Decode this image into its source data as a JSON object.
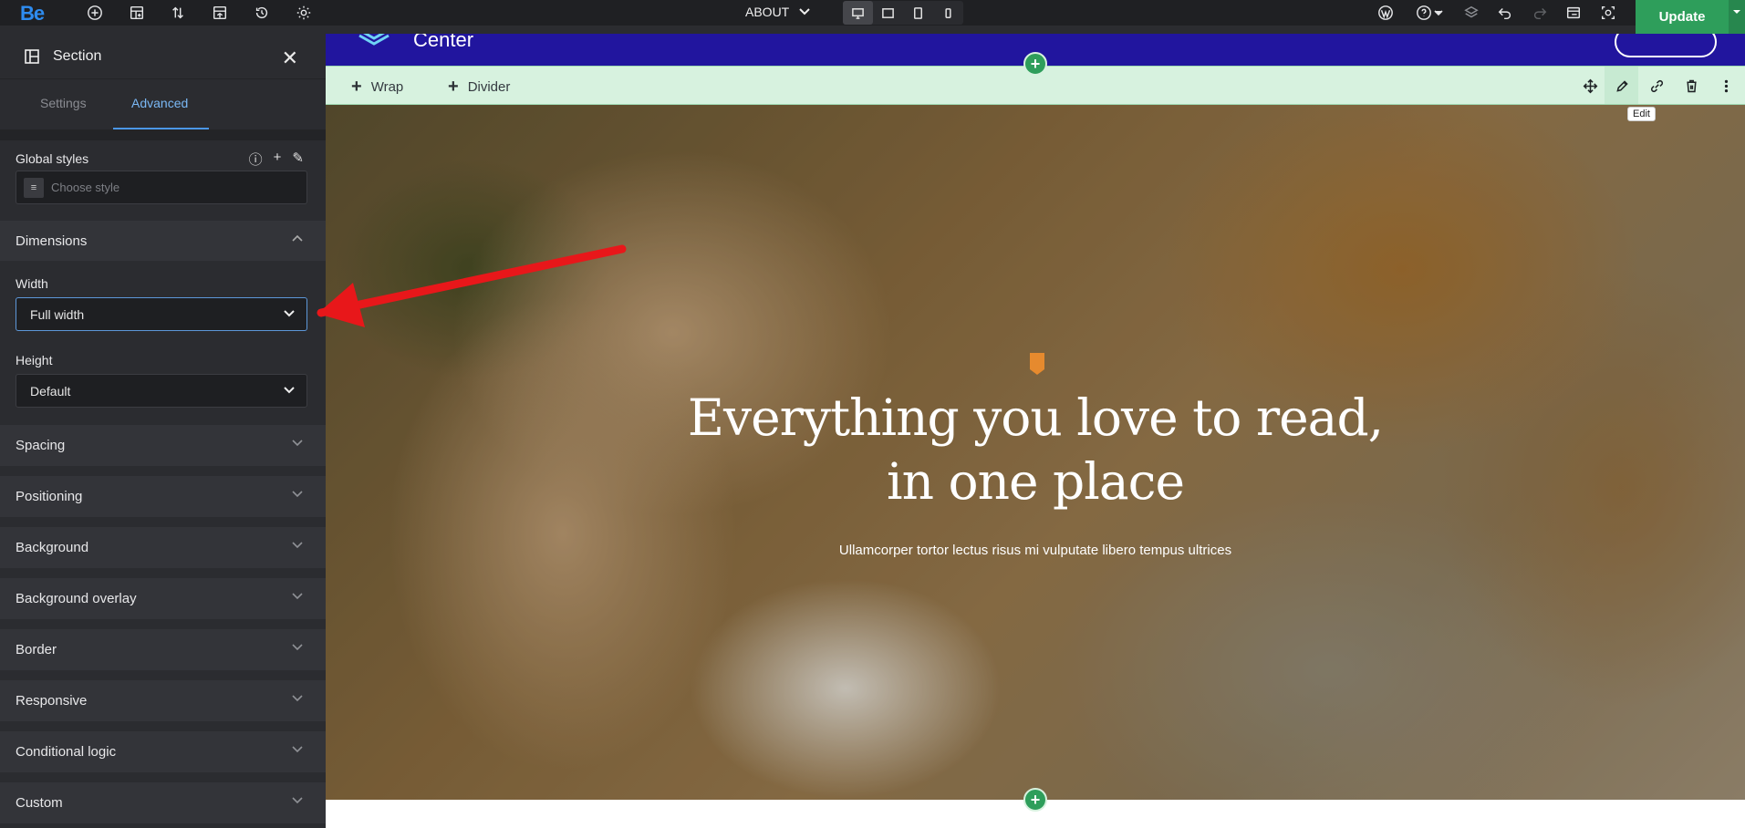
{
  "app": {
    "logo": "Be"
  },
  "topbar": {
    "page_name": "ABOUT",
    "update_label": "Update",
    "icons": [
      "add-icon",
      "layout-icon",
      "sort-icon",
      "templates-icon",
      "history-icon",
      "settings-icon",
      "wordpress-icon",
      "help-icon",
      "layers-icon",
      "undo-icon",
      "redo-icon",
      "preview-icon",
      "live-view-icon"
    ]
  },
  "sidebar": {
    "title": "Section",
    "tabs": [
      {
        "label": "Settings"
      },
      {
        "label": "Advanced"
      }
    ],
    "active_tab": "Advanced",
    "global_styles": {
      "label": "Global styles",
      "placeholder": "Choose style"
    },
    "dimensions": {
      "label": "Dimensions",
      "width": {
        "label": "Width",
        "value": "Full width"
      },
      "height": {
        "label": "Height",
        "value": "Default"
      }
    },
    "sections": [
      {
        "label": "Spacing"
      },
      {
        "label": "Positioning"
      },
      {
        "label": "Background"
      },
      {
        "label": "Background overlay"
      },
      {
        "label": "Border"
      },
      {
        "label": "Responsive"
      },
      {
        "label": "Conditional logic"
      },
      {
        "label": "Custom"
      }
    ]
  },
  "canvas": {
    "brand_text": "Center",
    "toolbar": {
      "wrap_label": "Wrap",
      "divider_label": "Divider",
      "tooltip": "Edit"
    },
    "hero": {
      "title_line1": "Everything you love to read,",
      "title_line2": "in one place",
      "subtitle": "Ullamcorper tortor lectus risus mi vulputate libero tempus ultrices"
    }
  },
  "colors": {
    "accent": "#2e9e5b",
    "brand_blue": "#21159e",
    "link": "#4b97e6",
    "arrow": "#e8171a"
  }
}
